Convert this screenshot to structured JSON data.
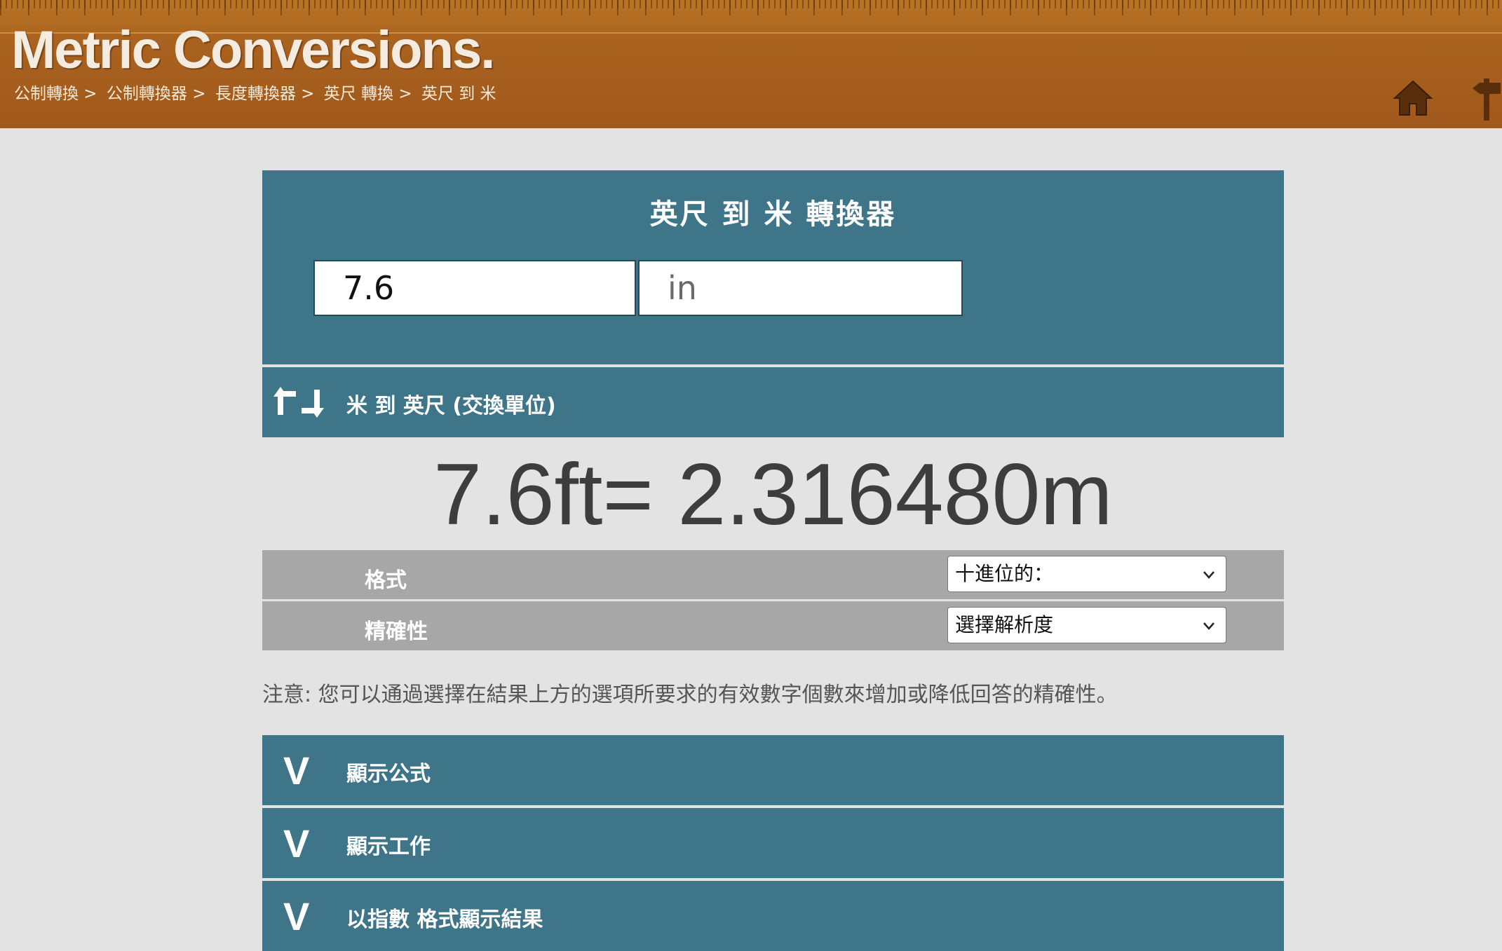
{
  "header": {
    "logo": "Metric Conversions.",
    "breadcrumb": [
      "公制轉換 >",
      "公制轉換器 >",
      "長度轉換器 >",
      "英尺 轉換 >",
      "英尺 到 米"
    ]
  },
  "converter": {
    "title": "英尺 到 米 轉換器",
    "value_input": "7.6",
    "unit_input": "in",
    "swap_label": "米 到 英尺 (交換單位)"
  },
  "result": "7.6ft= 2.316480m",
  "options": {
    "format_label": "格式",
    "format_value": "十進位的：",
    "precision_label": "精確性",
    "precision_value": "選擇解析度"
  },
  "note": "注意: 您可以通過選擇在結果上方的選項所要求的有效數字個數來增加或降低回答的精確性。",
  "accordions": [
    {
      "icon": "V",
      "label": "顯示公式"
    },
    {
      "icon": "V",
      "label": "顯示工作"
    },
    {
      "icon": "V",
      "label": "以指數 格式顯示結果"
    }
  ],
  "colors": {
    "header_brown": "#a9621f",
    "panel_teal": "#3e7589",
    "option_gray": "#a7a7a7",
    "background": "#e4e3e3"
  },
  "icons": [
    "home-icon",
    "signpost-icon",
    "swap-icon",
    "chevron-down-icon"
  ]
}
